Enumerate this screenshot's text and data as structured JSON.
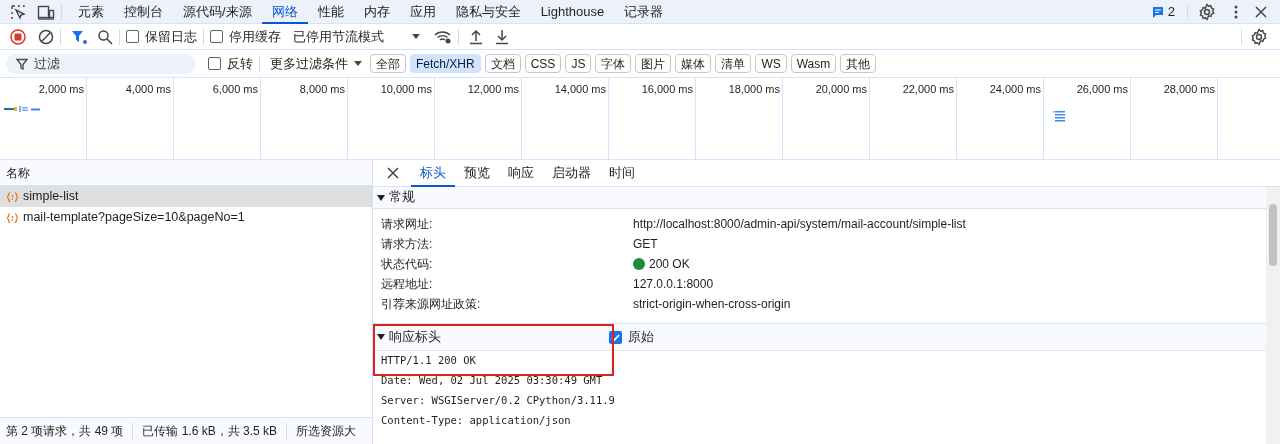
{
  "main_tabs": [
    {
      "label": "元素",
      "selected": false
    },
    {
      "label": "控制台",
      "selected": false
    },
    {
      "label": "源代码/来源",
      "selected": false
    },
    {
      "label": "网络",
      "selected": true
    },
    {
      "label": "性能",
      "selected": false
    },
    {
      "label": "内存",
      "selected": false
    },
    {
      "label": "应用",
      "selected": false
    },
    {
      "label": "隐私与安全",
      "selected": false
    },
    {
      "label": "Lighthouse",
      "selected": false
    },
    {
      "label": "记录器",
      "selected": false
    }
  ],
  "issues_count": "2",
  "toolbar": {
    "recording": true,
    "preserve_log": {
      "label": "保留日志",
      "checked": false
    },
    "disable_cache": {
      "label": "停用缓存",
      "checked": false
    },
    "throttling": "已停用节流模式"
  },
  "filter": {
    "placeholder": "过滤",
    "invert": {
      "label": "反转",
      "checked": false
    },
    "more_filters": "更多过滤条件",
    "types": [
      {
        "label": "全部",
        "selected": false
      },
      {
        "label": "Fetch/XHR",
        "selected": true
      },
      {
        "label": "文档",
        "selected": false
      },
      {
        "label": "CSS",
        "selected": false
      },
      {
        "label": "JS",
        "selected": false
      },
      {
        "label": "字体",
        "selected": false
      },
      {
        "label": "图片",
        "selected": false
      },
      {
        "label": "媒体",
        "selected": false
      },
      {
        "label": "清单",
        "selected": false
      },
      {
        "label": "WS",
        "selected": false
      },
      {
        "label": "Wasm",
        "selected": false
      },
      {
        "label": "其他",
        "selected": false
      }
    ]
  },
  "timeline": {
    "ticks": [
      "2,000 ms",
      "4,000 ms",
      "6,000 ms",
      "8,000 ms",
      "10,000 ms",
      "12,000 ms",
      "14,000 ms",
      "16,000 ms",
      "18,000 ms",
      "20,000 ms",
      "22,000 ms",
      "24,000 ms",
      "26,000 ms",
      "28,000 ms"
    ]
  },
  "requests": {
    "column": "名称",
    "rows": [
      {
        "name": "simple-list",
        "selected": true
      },
      {
        "name": "mail-template?pageSize=10&pageNo=1",
        "selected": false
      }
    ]
  },
  "status_bar": [
    "第 2 项请求，共 49 项",
    "已传输 1.6 kB，共 3.5 kB",
    "所选资源大"
  ],
  "detail_tabs": [
    {
      "label": "标头",
      "selected": true
    },
    {
      "label": "预览",
      "selected": false
    },
    {
      "label": "响应",
      "selected": false
    },
    {
      "label": "启动器",
      "selected": false
    },
    {
      "label": "时间",
      "selected": false
    }
  ],
  "general": {
    "title": "常规",
    "expanded": true,
    "rows": [
      {
        "label": "请求网址:",
        "value": "http://localhost:8000/admin-api/system/mail-account/simple-list"
      },
      {
        "label": "请求方法:",
        "value": "GET"
      },
      {
        "label": "状态代码:",
        "value": "200 OK",
        "color": "#1e8e3e"
      },
      {
        "label": "远程地址:",
        "value": "127.0.0.1:8000"
      },
      {
        "label": "引荐来源网址政策:",
        "value": "strict-origin-when-cross-origin"
      }
    ]
  },
  "response_headers": {
    "title": "响应标头",
    "expanded": true,
    "highlighted": true,
    "raw": {
      "label": "原始",
      "checked": true
    },
    "lines": [
      "HTTP/1.1 200 OK",
      "Date: Wed, 02 Jul 2025 03:30:49 GMT",
      "Server: WSGIServer/0.2 CPython/3.11.9",
      "Content-Type: application/json"
    ]
  }
}
